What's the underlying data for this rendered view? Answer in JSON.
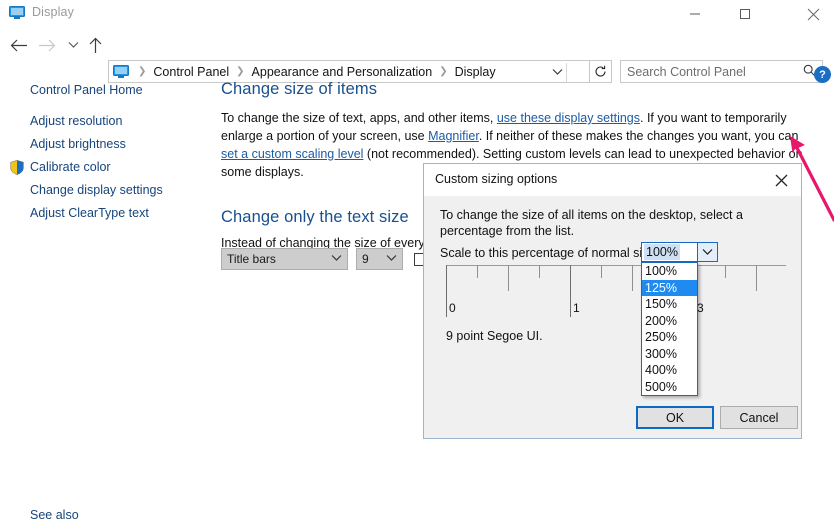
{
  "window": {
    "title": "Display",
    "icon": "monitor-icon",
    "minimize_label": "—",
    "maximize_label": "☐",
    "close_label": "✕"
  },
  "nav": {
    "back_icon": "←",
    "forward_icon": "→",
    "recent_icon": "⌄",
    "up_icon": "↑",
    "refresh_icon": "↻",
    "dropdown_icon": "⌄",
    "breadcrumbs": [
      "Control Panel",
      "Appearance and Personalization",
      "Display"
    ],
    "separator": "❯"
  },
  "search": {
    "placeholder": "Search Control Panel",
    "icon": "search-icon"
  },
  "help": {
    "label": "?"
  },
  "sidebar": {
    "home": "Control Panel Home",
    "items": [
      {
        "label": "Adjust resolution",
        "shield": false
      },
      {
        "label": "Adjust brightness",
        "shield": false
      },
      {
        "label": "Calibrate color",
        "shield": true
      },
      {
        "label": "Change display settings",
        "shield": false
      },
      {
        "label": "Adjust ClearType text",
        "shield": false
      }
    ],
    "see_also": "See also"
  },
  "content": {
    "heading1": "Change size of items",
    "paragraph": {
      "part1": "To change the size of text, apps, and other items, ",
      "link1": "use these display settings",
      "part2": ".  If you want to temporarily enlarge a portion of your screen, use ",
      "link2": "Magnifier",
      "part3": ".  If neither of these makes the changes you want, you can ",
      "link3": "set a custom scaling level",
      "part4": " (not recommended).  Setting custom levels can lead to unexpected behavior on some displays."
    },
    "heading2": "Change only the text size",
    "paragraph2": "Instead of changing the size of everyth",
    "element_combo": {
      "value": "Title bars",
      "caret": "⌄"
    },
    "size_combo": {
      "value": "9",
      "caret": "⌄"
    },
    "bold_checkbox": {
      "label": "",
      "checked": false
    }
  },
  "dialog": {
    "title": "Custom sizing options",
    "close_label": "✕",
    "description": "To change the size of all items on the desktop, select a percentage from the list.",
    "scale_label": "Scale to this percentage of normal size:",
    "scale_value": "100%",
    "scale_caret": "⌄",
    "dropdown_options": [
      "100%",
      "125%",
      "150%",
      "200%",
      "250%",
      "300%",
      "400%",
      "500%"
    ],
    "dropdown_selected": "125%",
    "ruler_numbers": [
      "0",
      "1",
      "3"
    ],
    "sample_text": "9 point Segoe UI.",
    "ok_label": "OK",
    "cancel_label": "Cancel"
  },
  "annotation": {
    "arrow_color": "#e8176b",
    "name": "pink-annotation-arrow"
  }
}
